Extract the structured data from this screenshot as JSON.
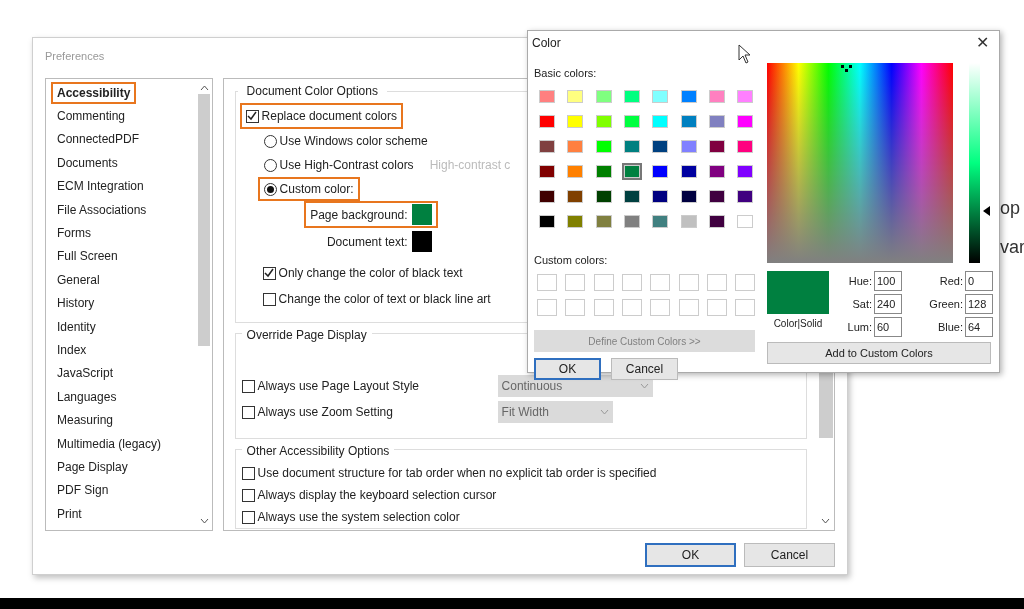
{
  "preferences": {
    "title": "Preferences",
    "categories": [
      {
        "label": "Accessibility",
        "selected": true,
        "highlighted": true
      },
      {
        "label": "Commenting",
        "selected": false,
        "highlighted": false
      },
      {
        "label": "ConnectedPDF",
        "selected": false,
        "highlighted": false
      },
      {
        "label": "Documents",
        "selected": false,
        "highlighted": false
      },
      {
        "label": "ECM Integration",
        "selected": false,
        "highlighted": false
      },
      {
        "label": "File Associations",
        "selected": false,
        "highlighted": false
      },
      {
        "label": "Forms",
        "selected": false,
        "highlighted": false
      },
      {
        "label": "Full Screen",
        "selected": false,
        "highlighted": false
      },
      {
        "label": "General",
        "selected": false,
        "highlighted": false
      },
      {
        "label": "History",
        "selected": false,
        "highlighted": false
      },
      {
        "label": "Identity",
        "selected": false,
        "highlighted": false
      },
      {
        "label": "Index",
        "selected": false,
        "highlighted": false
      },
      {
        "label": "JavaScript",
        "selected": false,
        "highlighted": false
      },
      {
        "label": "Languages",
        "selected": false,
        "highlighted": false
      },
      {
        "label": "Measuring",
        "selected": false,
        "highlighted": false
      },
      {
        "label": "Multimedia (legacy)",
        "selected": false,
        "highlighted": false
      },
      {
        "label": "Page Display",
        "selected": false,
        "highlighted": false
      },
      {
        "label": "PDF Sign",
        "selected": false,
        "highlighted": false
      },
      {
        "label": "Print",
        "selected": false,
        "highlighted": false
      }
    ],
    "document_color_options": {
      "title": "Document Color Options",
      "replace": {
        "label": "Replace document colors",
        "checked": true,
        "highlighted": true
      },
      "schemes": [
        {
          "label": "Use Windows color scheme",
          "selected": false,
          "highlighted": false
        },
        {
          "label": "Use High-Contrast colors",
          "selected": false,
          "highlighted": false,
          "hint": "High-contrast c"
        },
        {
          "label": "Custom color:",
          "selected": true,
          "highlighted": true
        }
      ],
      "swatches": [
        {
          "label": "Page background:",
          "color": "#008040",
          "highlighted": true
        },
        {
          "label": "Document text:",
          "color": "#000000",
          "highlighted": false
        }
      ],
      "options": [
        {
          "label": "Only change the color of black text",
          "checked": true
        },
        {
          "label": "Change the color of text or black line art",
          "checked": false
        }
      ]
    },
    "override_page_display": {
      "title": "Override Page Display",
      "options": [
        {
          "label": "Always use Page Layout Style",
          "checked": false,
          "value": "Continuous"
        },
        {
          "label": "Always use Zoom Setting",
          "checked": false,
          "value": "Fit Width"
        }
      ]
    },
    "other_options": {
      "title": "Other Accessibility Options",
      "options": [
        {
          "label": "Use document structure for tab order when no explicit tab order is specified",
          "checked": false
        },
        {
          "label": "Always display the keyboard selection cursor",
          "checked": false
        },
        {
          "label": "Always use the system selection color",
          "checked": false
        }
      ]
    },
    "buttons": [
      {
        "label": "OK",
        "default": true
      },
      {
        "label": "Cancel",
        "default": false
      }
    ]
  },
  "color_dialog": {
    "title": "Color",
    "close": "✕",
    "basic_colors_label": "Basic colors:",
    "basic_colors": [
      {
        "color": "#ff8080",
        "selected": false
      },
      {
        "color": "#ffff80",
        "selected": false
      },
      {
        "color": "#80ff80",
        "selected": false
      },
      {
        "color": "#00ff80",
        "selected": false
      },
      {
        "color": "#80ffff",
        "selected": false
      },
      {
        "color": "#0080ff",
        "selected": false
      },
      {
        "color": "#ff80c0",
        "selected": false
      },
      {
        "color": "#ff80ff",
        "selected": false
      },
      {
        "color": "#ff0000",
        "selected": false
      },
      {
        "color": "#ffff00",
        "selected": false
      },
      {
        "color": "#80ff00",
        "selected": false
      },
      {
        "color": "#00ff40",
        "selected": false
      },
      {
        "color": "#00ffff",
        "selected": false
      },
      {
        "color": "#0080c0",
        "selected": false
      },
      {
        "color": "#8080c0",
        "selected": false
      },
      {
        "color": "#ff00ff",
        "selected": false
      },
      {
        "color": "#804040",
        "selected": false
      },
      {
        "color": "#ff8040",
        "selected": false
      },
      {
        "color": "#00ff00",
        "selected": false
      },
      {
        "color": "#008080",
        "selected": false
      },
      {
        "color": "#004080",
        "selected": false
      },
      {
        "color": "#8080ff",
        "selected": false
      },
      {
        "color": "#800040",
        "selected": false
      },
      {
        "color": "#ff0080",
        "selected": false
      },
      {
        "color": "#800000",
        "selected": false
      },
      {
        "color": "#ff8000",
        "selected": false
      },
      {
        "color": "#008000",
        "selected": false
      },
      {
        "color": "#008040",
        "selected": true
      },
      {
        "color": "#0000ff",
        "selected": false
      },
      {
        "color": "#0000a0",
        "selected": false
      },
      {
        "color": "#800080",
        "selected": false
      },
      {
        "color": "#8000ff",
        "selected": false
      },
      {
        "color": "#400000",
        "selected": false
      },
      {
        "color": "#804000",
        "selected": false
      },
      {
        "color": "#004000",
        "selected": false
      },
      {
        "color": "#004040",
        "selected": false
      },
      {
        "color": "#000080",
        "selected": false
      },
      {
        "color": "#000040",
        "selected": false
      },
      {
        "color": "#400040",
        "selected": false
      },
      {
        "color": "#400080",
        "selected": false
      },
      {
        "color": "#000000",
        "selected": false
      },
      {
        "color": "#808000",
        "selected": false
      },
      {
        "color": "#808040",
        "selected": false
      },
      {
        "color": "#808080",
        "selected": false
      },
      {
        "color": "#408080",
        "selected": false
      },
      {
        "color": "#c0c0c0",
        "selected": false
      },
      {
        "color": "#400040",
        "selected": false
      },
      {
        "color": "#ffffff",
        "selected": false
      }
    ],
    "custom_colors_label": "Custom colors:",
    "define_button": {
      "label": "Define Custom Colors >>",
      "disabled": true
    },
    "buttons": [
      {
        "label": "OK",
        "default": true
      },
      {
        "label": "Cancel",
        "default": false
      }
    ],
    "current_label": "Color|Solid",
    "fields_left": [
      {
        "label": "Hue:",
        "value": "100"
      },
      {
        "label": "Sat:",
        "value": "240"
      },
      {
        "label": "Lum:",
        "value": "60"
      }
    ],
    "fields_right": [
      {
        "label": "Red:",
        "value": "0"
      },
      {
        "label": "Green:",
        "value": "128"
      },
      {
        "label": "Blue:",
        "value": "64"
      }
    ],
    "add_button": "Add to Custom Colors"
  },
  "background_fragments": [
    "op",
    "var"
  ]
}
